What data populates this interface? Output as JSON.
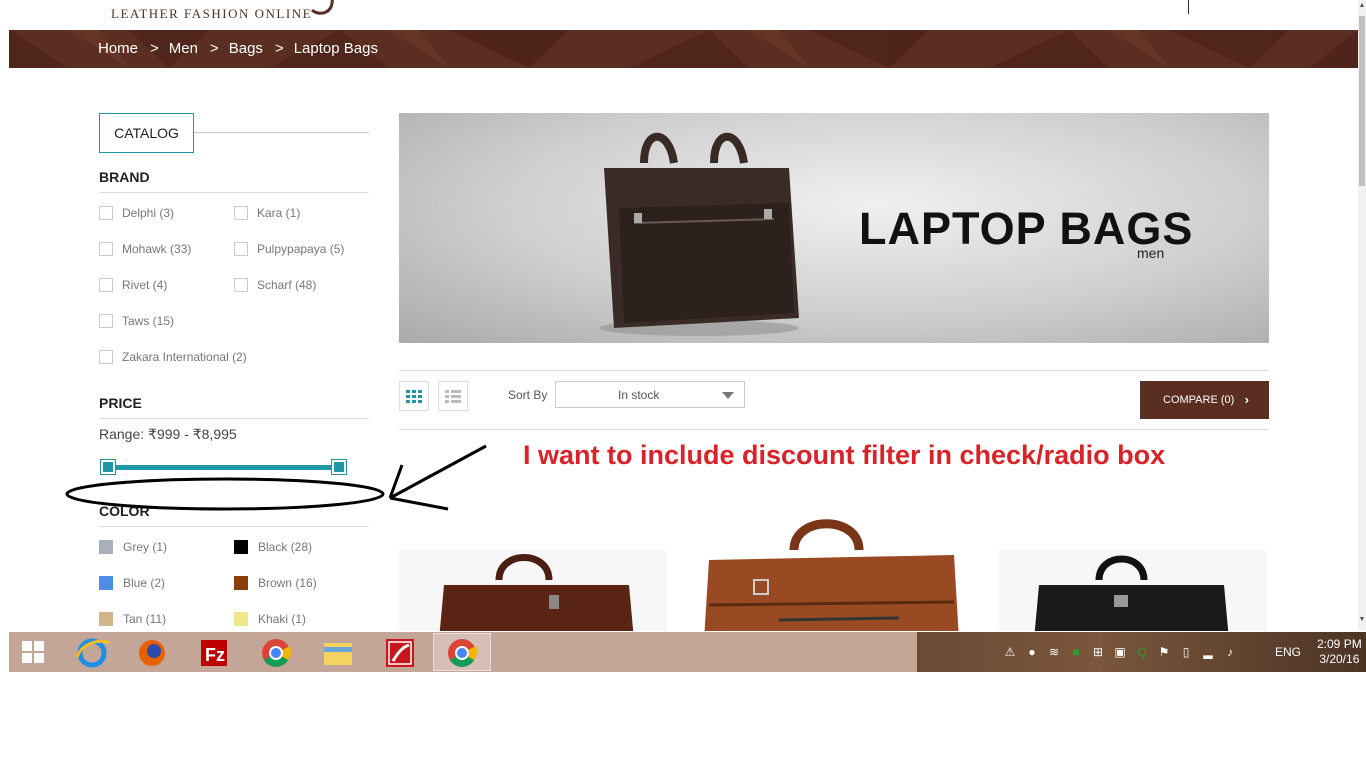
{
  "header": {
    "logo_text": "LEATHER FASHION ONLINE"
  },
  "breadcrumb": [
    "Home",
    "Men",
    "Bags",
    "Laptop Bags"
  ],
  "breadcrumb_separator": ">",
  "sidebar": {
    "catalog_label": "CATALOG",
    "brand": {
      "title": "BRAND",
      "items": [
        "Delphi (3)",
        "Kara (1)",
        "Mohawk (33)",
        "Pulpypapaya (5)",
        "Rivet (4)",
        "Scharf (48)",
        "Taws (15)",
        "Zakara International (2)"
      ]
    },
    "price": {
      "title": "PRICE",
      "range_text": "Range: ₹999 - ₹8,995",
      "slider_min_fraction": 0.0,
      "slider_max_fraction": 1.0
    },
    "color": {
      "title": "COLOR",
      "items": [
        {
          "label": "Grey (1)",
          "color": "#a8b0bc"
        },
        {
          "label": "Black (28)",
          "color": "#000000"
        },
        {
          "label": "Blue (2)",
          "color": "#4e8de6"
        },
        {
          "label": "Brown (16)",
          "color": "#8a3f0a"
        },
        {
          "label": "Tan (11)",
          "color": "#d2b48c"
        },
        {
          "label": "Khaki (1)",
          "color": "#f0e68c"
        }
      ]
    }
  },
  "banner": {
    "title": "LAPTOP BAGS",
    "subtitle": "men"
  },
  "toolbar": {
    "grid_view_icon": "grid-view-icon",
    "list_view_icon": "list-view-icon",
    "sort_label": "Sort By",
    "sort_value": "In stock",
    "compare_label": "COMPARE (0)"
  },
  "annotation": {
    "text": "I want to include discount filter in check/radio box"
  },
  "taskbar": {
    "apps": [
      "windows-start-icon",
      "internet-explorer-icon",
      "firefox-icon",
      "filezilla-icon",
      "chrome-icon",
      "file-explorer-icon",
      "flash-app-icon",
      "chrome-active-icon"
    ],
    "language": "ENG",
    "time": "2:09 PM",
    "date": "3/20/16"
  },
  "colors": {
    "brand_brown": "#5b2e22",
    "accent_teal": "#1e98a4",
    "annotation_red": "#d8232a"
  }
}
